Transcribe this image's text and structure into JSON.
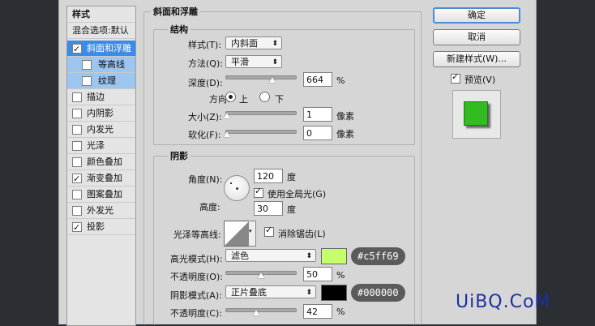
{
  "styles_panel": {
    "header": "样式",
    "blend_options": "混合选项:默认",
    "items": [
      {
        "label": "斜面和浮雕",
        "checked": true
      },
      {
        "label": "等高线",
        "checked": false
      },
      {
        "label": "纹理",
        "checked": false
      },
      {
        "label": "描边",
        "checked": false
      },
      {
        "label": "内阴影",
        "checked": false
      },
      {
        "label": "内发光",
        "checked": false
      },
      {
        "label": "光泽",
        "checked": false
      },
      {
        "label": "颜色叠加",
        "checked": false
      },
      {
        "label": "渐变叠加",
        "checked": true
      },
      {
        "label": "图案叠加",
        "checked": false
      },
      {
        "label": "外发光",
        "checked": false
      },
      {
        "label": "投影",
        "checked": true
      }
    ]
  },
  "bevel": {
    "title": "斜面和浮雕",
    "structure_title": "结构",
    "style_label": "样式(T):",
    "style_value": "内斜面",
    "technique_label": "方法(Q):",
    "technique_value": "平滑",
    "depth_label": "深度(D):",
    "depth_value": "664",
    "depth_unit": "%",
    "direction_label": "方向:",
    "direction_up": "上",
    "direction_down": "下",
    "size_label": "大小(Z):",
    "size_value": "1",
    "size_unit": "像素",
    "soften_label": "软化(F):",
    "soften_value": "0",
    "soften_unit": "像素"
  },
  "shading": {
    "title": "阴影",
    "angle_label": "角度(N):",
    "angle_value": "120",
    "angle_unit": "度",
    "global_light_label": "使用全局光(G)",
    "altitude_label": "高度:",
    "altitude_value": "30",
    "altitude_unit": "度",
    "gloss_label": "光泽等高线:",
    "antialias_label": "消除锯齿(L)",
    "highlight_label": "高光模式(H):",
    "highlight_mode": "滤色",
    "highlight_color": "#c5ff69",
    "highlight_hex_text": "#c5ff69",
    "highlight_opacity_label": "不透明度(O):",
    "highlight_opacity": "50",
    "shadow_label": "阴影模式(A):",
    "shadow_mode": "正片叠底",
    "shadow_color": "#000000",
    "shadow_hex_text": "#000000",
    "shadow_opacity_label": "不透明度(C):",
    "shadow_opacity": "42",
    "pct": "%"
  },
  "buttons": {
    "ok": "确定",
    "cancel": "取消",
    "new_style": "新建样式(W)...",
    "preview_label": "预览(V)"
  },
  "preview_color": "#33bb22",
  "watermark": {
    "part1": "UiBQ",
    "part2": ".CoM"
  }
}
